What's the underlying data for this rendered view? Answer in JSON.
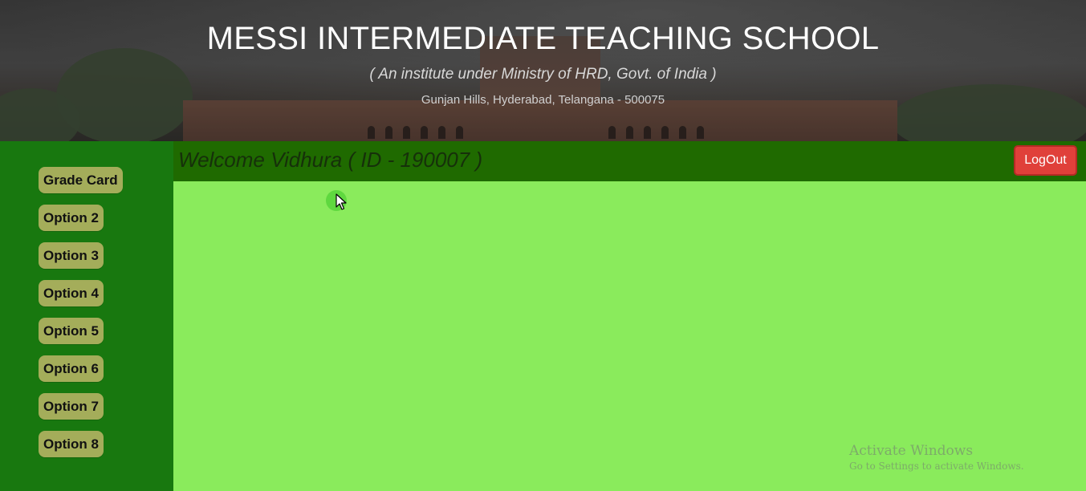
{
  "header": {
    "title": "MESSI INTERMEDIATE TEACHING SCHOOL",
    "subtitle": "( An institute under Ministry of HRD, Govt. of India )",
    "address": "Gunjan Hills, Hyderabad, Telangana - 500075"
  },
  "sidebar": {
    "items": [
      {
        "label": "Grade Card"
      },
      {
        "label": "Option 2"
      },
      {
        "label": "Option 3"
      },
      {
        "label": "Option 4"
      },
      {
        "label": "Option 5"
      },
      {
        "label": "Option 6"
      },
      {
        "label": "Option 7"
      },
      {
        "label": "Option 8"
      }
    ]
  },
  "welcome": {
    "text": "Welcome Vidhura ( ID - 190007 )",
    "logout_label": "LogOut"
  },
  "watermark": {
    "line1": "Activate Windows",
    "line2": "Go to Settings to activate Windows."
  },
  "colors": {
    "sidebar": "#18780f",
    "welcome_bar": "#1f6a00",
    "content": "#8aeb5c",
    "nav_button": "#a4ad5a",
    "logout": "#e0403a"
  }
}
